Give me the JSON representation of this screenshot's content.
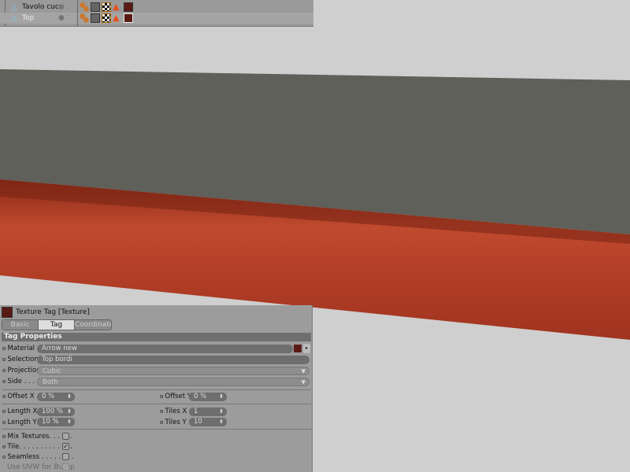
{
  "object_manager": {
    "objects": [
      {
        "name": "Tavolo cuc",
        "icon": "polygon-object-icon"
      },
      {
        "name": "Top",
        "icon": "polygon-object-icon"
      }
    ]
  },
  "attributes": {
    "title": "Texture Tag [Texture]",
    "tabs": [
      {
        "label": "Basic"
      },
      {
        "label": "Tag",
        "active": true
      },
      {
        "label": "Coordinates"
      }
    ],
    "section": "Tag Properties",
    "material": {
      "label": "Material",
      "value": "Arrow new"
    },
    "selection": {
      "label": "Selection",
      "value": "Top bordi"
    },
    "projection": {
      "label": "Projection",
      "value": "Cubic"
    },
    "side": {
      "label": "Side . . . .",
      "value": "Both"
    },
    "offset_x": {
      "label": "Offset X",
      "value": "0 %"
    },
    "offset_y": {
      "label": "Offset Y",
      "value": "0 %"
    },
    "length_x": {
      "label": "Length X",
      "value": "100 %"
    },
    "length_y": {
      "label": "Length Y",
      "value": "10 %"
    },
    "tiles_x": {
      "label": "Tiles X",
      "value": "1"
    },
    "tiles_y": {
      "label": "Tiles Y",
      "value": "10"
    },
    "mix_textures": {
      "label": "Mix Textures. . . . . .",
      "checked": false
    },
    "tile": {
      "label": "Tile. . . . . . . . . . . . .",
      "checked": true
    },
    "seamless": {
      "label": "Seamless . . . . . . . .",
      "checked": false
    },
    "use_uvw": {
      "label": "Use UVW for Bump",
      "checked": true,
      "disabled": true
    }
  },
  "colors": {
    "viewport_bg": "#cfcfcf",
    "slab_top": "#5f6059",
    "wood": "#b6432a",
    "material_swatch": "#5a1a14"
  }
}
